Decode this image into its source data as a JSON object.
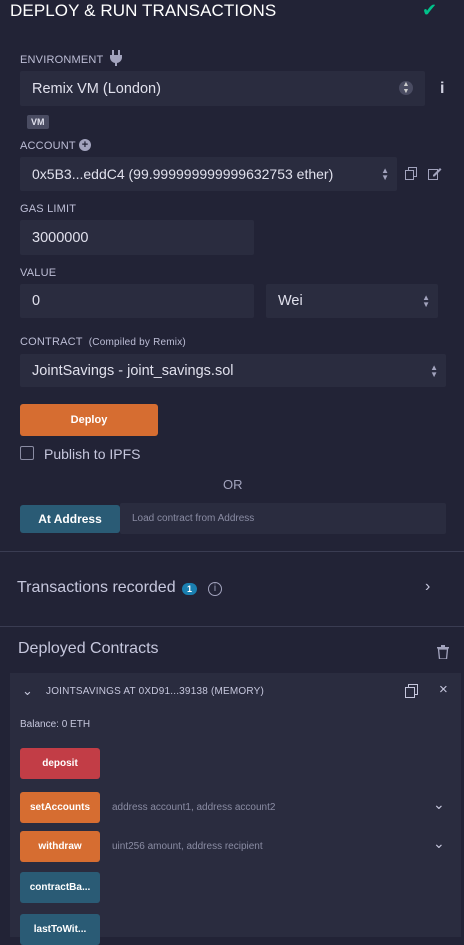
{
  "header": {
    "title": "DEPLOY & RUN TRANSACTIONS",
    "status_icon": "check-icon"
  },
  "environment": {
    "label": "ENVIRONMENT",
    "value": "Remix VM (London)",
    "badge": "VM"
  },
  "account": {
    "label": "ACCOUNT",
    "value": "0x5B3...eddC4 (99.999999999999632753 ether)"
  },
  "gas_limit": {
    "label": "GAS LIMIT",
    "value": "3000000"
  },
  "value": {
    "label": "VALUE",
    "amount": "0",
    "unit": "Wei"
  },
  "contract": {
    "label": "CONTRACT",
    "sublabel": "(Compiled by Remix)",
    "value": "JointSavings - joint_savings.sol"
  },
  "deploy": {
    "button": "Deploy",
    "publish_label": "Publish to IPFS",
    "or": "OR",
    "at_address_button": "At Address",
    "at_address_placeholder": "Load contract from Address"
  },
  "transactions": {
    "label": "Transactions recorded",
    "count": "1"
  },
  "deployed": {
    "title": "Deployed Contracts",
    "instance_title": "JOINTSAVINGS AT 0XD91...39138 (MEMORY)",
    "balance": "Balance: 0 ETH",
    "functions": [
      {
        "name": "deposit",
        "color": "#c23d46",
        "placeholder": "",
        "expandable": false
      },
      {
        "name": "setAccounts",
        "color": "#d66d31",
        "placeholder": "address account1, address account2",
        "expandable": true
      },
      {
        "name": "withdraw",
        "color": "#d66d31",
        "placeholder": "uint256 amount, address recipient",
        "expandable": true
      },
      {
        "name": "contractBa...",
        "color": "#2a5b75",
        "placeholder": "",
        "expandable": false
      },
      {
        "name": "lastToWit...",
        "color": "#2a5b75",
        "placeholder": "",
        "expandable": false
      }
    ]
  },
  "colors": {
    "background": "#222336",
    "input": "#2a2c3f",
    "deploy_orange": "#d66d31",
    "payable_red": "#c23d46",
    "call_blue": "#2a5b75",
    "success_green": "#00c28b"
  }
}
